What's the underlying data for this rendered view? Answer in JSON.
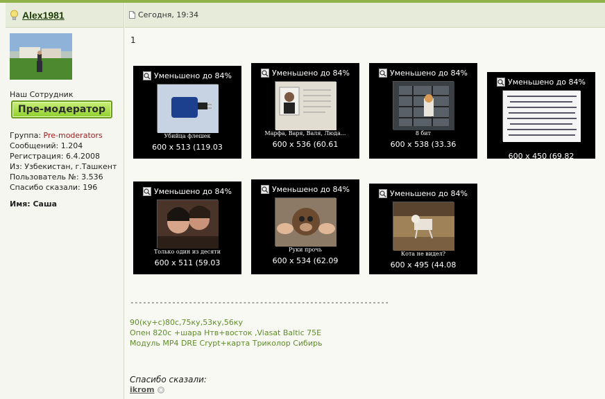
{
  "user": {
    "name": "Alex1981",
    "staff_title": "Наш Сотрудник",
    "rank_badge": "Пре-модератор",
    "group_label": "Группа: ",
    "group_value": "Pre-moderators",
    "messages": "Сообщений: 1.204",
    "registered": "Регистрация: 6.4.2008",
    "from": "Из: Узбекистан, г.Ташкент",
    "user_no": "Пользователь №: 3.536",
    "thanked": "Спасибо сказали: 196",
    "name_line": "Имя: Саша"
  },
  "post": {
    "date": "Сегодня, 19:34",
    "number": "1",
    "thumbnails": [
      {
        "label": "Уменьшено до 84%",
        "caption": "Убийца флешек",
        "size": "600 x 513 (119.03",
        "icon": "magnifier-icon"
      },
      {
        "label": "Уменьшено до 84%",
        "caption": "Марфа, Варя, Валя, Люда...",
        "size": "600 x 536 (60.61",
        "icon": "magnifier-icon"
      },
      {
        "label": "Уменьшено до 84%",
        "caption": "8 бит",
        "size": "600 x 538 (33.36",
        "icon": "magnifier-icon"
      },
      {
        "label": "Уменьшено до 84%",
        "caption": "",
        "size": "600 x 450 (69.82",
        "icon": "magnifier-icon"
      },
      {
        "label": "Уменьшено до 84%",
        "caption": "Только один из десяти",
        "size": "600 x 511 (59.03",
        "icon": "magnifier-icon"
      },
      {
        "label": "Уменьшено до 84%",
        "caption": "Руки прочь",
        "size": "600 x 534 (62.09",
        "icon": "magnifier-icon"
      },
      {
        "label": "Уменьшено до 84%",
        "caption": "Кота не видел?",
        "size": "600 x 495 (44.08",
        "icon": "magnifier-icon"
      }
    ],
    "separator": "--------------------------------------------------------------",
    "signature": [
      "90(ку+с)80с,75ку,53ку,56ку",
      "Опен 820с +шара Нтв+восток ,Viasat Baltic 75E",
      "Модуль MP4 DRE Crypt+карта Триколор Сибирь"
    ],
    "thanks_label": "Спасибо сказали:",
    "thanks_user": "ikrom"
  },
  "colors": {
    "accent": "#8fb24a",
    "signature": "#5e8c28",
    "group": "#9b1b1b",
    "badge_fill": "#a8df4c"
  }
}
